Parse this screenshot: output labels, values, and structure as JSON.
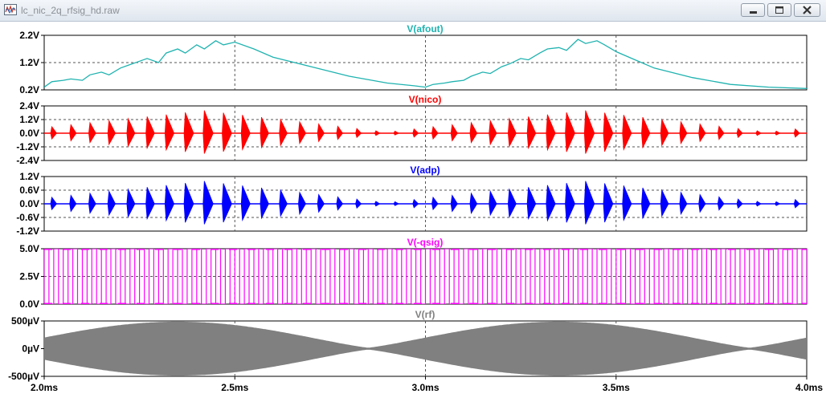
{
  "window": {
    "title": "lc_nic_2q_rfsig_hd.raw"
  },
  "icons": {
    "app": "waveform-app-icon",
    "minimize": "minimize-icon",
    "maximize": "maximize-icon",
    "close": "close-icon"
  },
  "colors": {
    "afout": "#1fb3b0",
    "nico": "#ff0000",
    "adp": "#0000ff",
    "qsig": "#ff00ff",
    "rf": "#808080",
    "grid": "#555555",
    "frame": "#000000"
  },
  "chart_data": [
    {
      "type": "line",
      "title": "V(afout)",
      "y_ticks": [
        "2.2V",
        "1.2V",
        "0.2V"
      ],
      "ylim": [
        0.2,
        2.2
      ],
      "x": [
        2.0,
        2.02,
        2.05,
        2.07,
        2.1,
        2.12,
        2.15,
        2.17,
        2.2,
        2.22,
        2.25,
        2.27,
        2.3,
        2.32,
        2.35,
        2.37,
        2.4,
        2.42,
        2.45,
        2.47,
        2.5,
        2.55,
        2.6,
        2.7,
        2.8,
        2.9,
        2.97,
        3.0,
        3.02,
        3.05,
        3.07,
        3.1,
        3.12,
        3.15,
        3.17,
        3.2,
        3.22,
        3.25,
        3.27,
        3.3,
        3.32,
        3.35,
        3.37,
        3.4,
        3.42,
        3.45,
        3.47,
        3.5,
        3.55,
        3.6,
        3.7,
        3.8,
        3.9,
        4.0
      ],
      "y": [
        0.3,
        0.5,
        0.55,
        0.6,
        0.55,
        0.75,
        0.85,
        0.75,
        1.0,
        1.1,
        1.25,
        1.35,
        1.2,
        1.55,
        1.7,
        1.55,
        1.85,
        1.7,
        2.0,
        1.85,
        1.95,
        1.7,
        1.4,
        1.05,
        0.7,
        0.45,
        0.35,
        0.3,
        0.4,
        0.45,
        0.5,
        0.55,
        0.7,
        0.85,
        0.8,
        1.05,
        1.15,
        1.35,
        1.3,
        1.55,
        1.7,
        1.75,
        1.65,
        2.05,
        1.9,
        2.0,
        1.85,
        1.6,
        1.3,
        1.0,
        0.65,
        0.4,
        0.3,
        0.25
      ]
    },
    {
      "type": "line",
      "title": "V(nico)",
      "y_ticks": [
        "2.4V",
        "1.2V",
        "0.0V",
        "-1.2V",
        "-2.4V"
      ],
      "ylim": [
        -2.4,
        2.4
      ],
      "peak_amplitude": 2.0,
      "burst_interval_ms": 0.05
    },
    {
      "type": "line",
      "title": "V(adp)",
      "y_ticks": [
        "1.2V",
        "0.6V",
        "0.0V",
        "-0.6V",
        "-1.2V"
      ],
      "ylim": [
        -1.2,
        1.2
      ],
      "peak_amplitude": 1.0,
      "burst_interval_ms": 0.05
    },
    {
      "type": "line",
      "title": "V(-qsig)",
      "y_ticks": [
        "5.0V",
        "2.5V",
        "0.0V"
      ],
      "ylim": [
        0.0,
        5.0
      ],
      "high": 5.0,
      "low": 0.0,
      "period_ms": 0.025
    },
    {
      "type": "area",
      "title": "V(rf)",
      "y_ticks": [
        "500µV",
        "0µV",
        "-500µV"
      ],
      "ylim": [
        -500,
        500
      ],
      "envelope_peak": 480,
      "envelope_min": 10
    }
  ],
  "x_axis": {
    "ticks": [
      "2.0ms",
      "2.5ms",
      "3.0ms",
      "3.5ms",
      "4.0ms"
    ],
    "range": [
      2.0,
      4.0
    ]
  }
}
